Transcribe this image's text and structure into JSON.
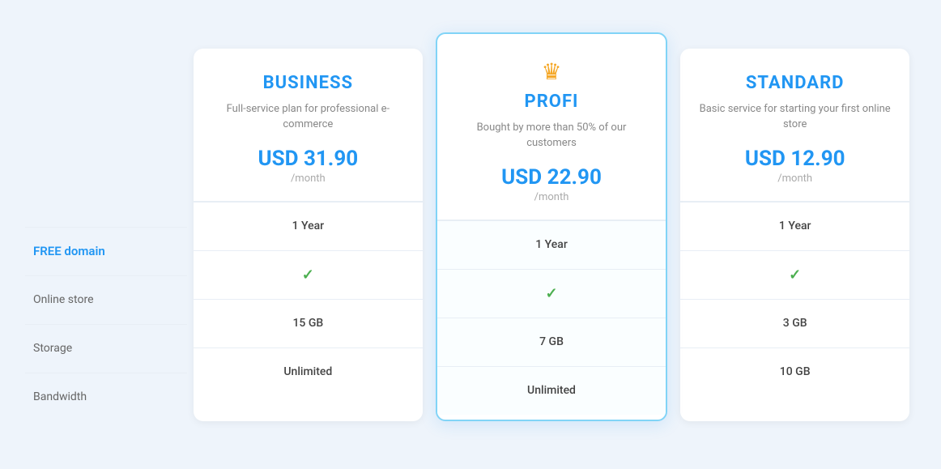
{
  "features": {
    "labels": [
      {
        "id": "free-domain",
        "text": "FREE domain",
        "style": "free-domain"
      },
      {
        "id": "online-store",
        "text": "Online store",
        "style": ""
      },
      {
        "id": "storage",
        "text": "Storage",
        "style": ""
      },
      {
        "id": "bandwidth",
        "text": "Bandwidth",
        "style": ""
      }
    ]
  },
  "plans": [
    {
      "id": "business",
      "name": "BUSINESS",
      "description": "Full-service plan for professional e-commerce",
      "price": "USD 31.90",
      "period": "/month",
      "featured": false,
      "crown": false,
      "features": [
        {
          "id": "free-domain",
          "value": "1 Year",
          "type": "text"
        },
        {
          "id": "online-store",
          "value": "✓",
          "type": "check"
        },
        {
          "id": "storage",
          "value": "15 GB",
          "type": "text"
        },
        {
          "id": "bandwidth",
          "value": "Unlimited",
          "type": "text"
        }
      ]
    },
    {
      "id": "profi",
      "name": "PROFI",
      "description": "Bought by more than 50% of our customers",
      "price": "USD 22.90",
      "period": "/month",
      "featured": true,
      "crown": true,
      "features": [
        {
          "id": "free-domain",
          "value": "1 Year",
          "type": "text"
        },
        {
          "id": "online-store",
          "value": "✓",
          "type": "check"
        },
        {
          "id": "storage",
          "value": "7 GB",
          "type": "text"
        },
        {
          "id": "bandwidth",
          "value": "Unlimited",
          "type": "text"
        }
      ]
    },
    {
      "id": "standard",
      "name": "STANDARD",
      "description": "Basic service for starting your first online store",
      "price": "USD 12.90",
      "period": "/month",
      "featured": false,
      "crown": false,
      "features": [
        {
          "id": "free-domain",
          "value": "1 Year",
          "type": "text"
        },
        {
          "id": "online-store",
          "value": "✓",
          "type": "check"
        },
        {
          "id": "storage",
          "value": "3 GB",
          "type": "text"
        },
        {
          "id": "bandwidth",
          "value": "10 GB",
          "type": "text"
        }
      ]
    }
  ]
}
